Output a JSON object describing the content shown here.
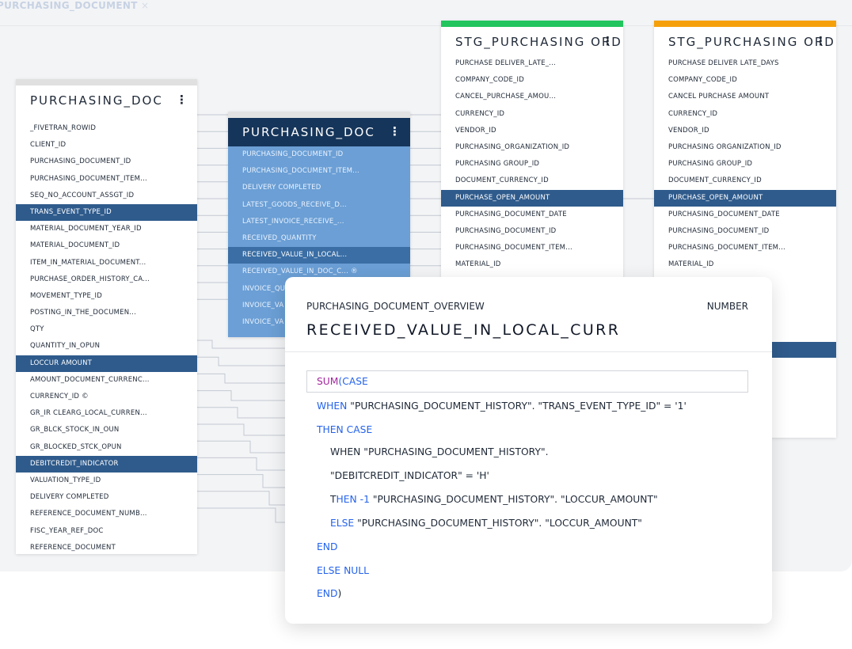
{
  "tab": {
    "title": "PURCHASING_DOCUMENT",
    "close_icon": "close-icon"
  },
  "colors": {
    "selected_row": "#2f5b8c",
    "blue_card": "#6b9fd5",
    "blue_card_header": "#16355a",
    "stg1_accent": "#22c55e",
    "stg2_accent": "#f5a00b",
    "keyword": "#2563eb",
    "function": "#a3279e"
  },
  "card_left": {
    "title": "PURCHASING_DOC",
    "menu_icon": "kebab-menu-icon",
    "rows": [
      {
        "label": "_FIVETRAN_ROWID",
        "selected": false
      },
      {
        "label": "CLIENT_ID",
        "selected": false
      },
      {
        "label": "PURCHASING_DOCUMENT_ID",
        "selected": false
      },
      {
        "label": "PURCHASING_DOCUMENT_ITEM...",
        "selected": false
      },
      {
        "label": "SEQ_NO_ACCOUNT_ASSGT_ID",
        "selected": false
      },
      {
        "label": "TRANS_EVENT_TYPE_ID",
        "selected": true
      },
      {
        "label": "MATERIAL_DOCUMENT_YEAR_ID",
        "selected": false
      },
      {
        "label": "MATERIAL_DOCUMENT_ID",
        "selected": false
      },
      {
        "label": "ITEM_IN_MATERIAL_DOCUMENT...",
        "selected": false
      },
      {
        "label": "PURCHASE_ORDER_HISTORY_CA...",
        "selected": false
      },
      {
        "label": "MOVEMENT_TYPE_ID",
        "selected": false
      },
      {
        "label": "POSTING_IN_THE_DOCUMEN...",
        "selected": false
      },
      {
        "label": "QTY",
        "selected": false
      },
      {
        "label": "QUANTITY_IN_OPUN",
        "selected": false
      },
      {
        "label": "LOCCUR AMOUNT",
        "selected": true
      },
      {
        "label": "AMOUNT_DOCUMENT_CURRENC...",
        "selected": false
      },
      {
        "label": "CURRENCY_ID ©",
        "selected": false
      },
      {
        "label": "GR_IR CLEARG_LOCAL_CURREN...",
        "selected": false
      },
      {
        "label": "GR_BLCK_STOCK_IN_OUN",
        "selected": false
      },
      {
        "label": "GR_BLOCKED_STCK_OPUN",
        "selected": false
      },
      {
        "label": "DEBITCREDIT_INDICATOR",
        "selected": true
      },
      {
        "label": "VALUATION_TYPE_ID",
        "selected": false
      },
      {
        "label": "DELIVERY COMPLETED",
        "selected": false
      },
      {
        "label": "REFERENCE_DOCUMENT_NUMB...",
        "selected": false
      },
      {
        "label": "FISC_YEAR_REF_DOC",
        "selected": false
      },
      {
        "label": "REFERENCE_DOCUMENT",
        "selected": false
      }
    ]
  },
  "card_blue": {
    "title": "PURCHASING_DOC",
    "menu_icon": "kebab-menu-icon",
    "rows": [
      {
        "label": "PURCHASING_DOCUMENT_ID",
        "selected": false
      },
      {
        "label": "PURCHASING_DOCUMENT_ITEM...",
        "selected": false
      },
      {
        "label": "DELIVERY COMPLETED",
        "selected": false
      },
      {
        "label": "LATEST_GOODS_RECEIVE_D...",
        "selected": false
      },
      {
        "label": "LATEST_INVOICE_RECEIVE_...",
        "selected": false
      },
      {
        "label": "RECEIVED_QUANTITY",
        "selected": false
      },
      {
        "label": "RECEIVED_VALUE_IN_LOCAL...",
        "selected": true
      },
      {
        "label": "RECEIVED_VALUE_IN_DOC_C... ®",
        "selected": false
      },
      {
        "label": "INVOICE_QU",
        "selected": false
      },
      {
        "label": "INVOICE_VA",
        "selected": false
      },
      {
        "label": "INVOICE_VA",
        "selected": false
      }
    ]
  },
  "card_stg_1": {
    "title": "STG_PURCHASING ORD",
    "menu_icon": "kebab-menu-icon",
    "rows": [
      {
        "label": "PURCHASE DELIVER_LATE_...",
        "selected": false
      },
      {
        "label": "COMPANY_CODE_ID",
        "selected": false
      },
      {
        "label": "CANCEL_PURCHASE_AMOU...",
        "selected": false
      },
      {
        "label": "CURRENCY_ID",
        "selected": false
      },
      {
        "label": "VENDOR_ID",
        "selected": false
      },
      {
        "label": "PURCHASING_ORGANIZATION_ID",
        "selected": false
      },
      {
        "label": "PURCHASING GROUP_ID",
        "selected": false
      },
      {
        "label": "DOCUMENT_CURRENCY_ID",
        "selected": false
      },
      {
        "label": "PURCHASE_OPEN_AMOUNT",
        "selected": true
      },
      {
        "label": "PURCHASING_DOCUMENT_DATE",
        "selected": false
      },
      {
        "label": "PURCHASING_DOCUMENT_ID",
        "selected": false
      },
      {
        "label": "PURCHASING_DOCUMENT_ITEM...",
        "selected": false
      },
      {
        "label": "MATERIAL_ID",
        "selected": false
      }
    ]
  },
  "card_stg_2": {
    "title": "STG_PURCHASING ORD",
    "menu_icon": "kebab-menu-icon",
    "rows": [
      {
        "label": "PURCHASE DELIVER LATE_DAYS",
        "selected": false
      },
      {
        "label": "COMPANY_CODE_ID",
        "selected": false
      },
      {
        "label": "CANCEL PURCHASE AMOUNT",
        "selected": false
      },
      {
        "label": "CURRENCY_ID",
        "selected": false
      },
      {
        "label": "VENDOR_ID",
        "selected": false
      },
      {
        "label": "PURCHASING ORGANIZATION_ID",
        "selected": false
      },
      {
        "label": "PURCHASING GROUP_ID",
        "selected": false
      },
      {
        "label": "DOCUMENT_CURRENCY_ID",
        "selected": false
      },
      {
        "label": "PURCHASE_OPEN_AMOUNT",
        "selected": true
      },
      {
        "label": "PURCHASING_DOCUMENT_DATE",
        "selected": false
      },
      {
        "label": "PURCHASING_DOCUMENT_ID",
        "selected": false
      },
      {
        "label": "PURCHASING_DOCUMENT_ITEM...",
        "selected": false
      },
      {
        "label": "MATERIAL_ID",
        "selected": false
      }
    ]
  },
  "detail": {
    "source": "PURCHASING_DOCUMENT_OVERVIEW",
    "data_type": "NUMBER",
    "field_name": "RECEIVED_VALUE_IN_LOCAL_CURR",
    "code": {
      "sum_fn": "SUM",
      "paren_open": "(",
      "case_kw": "CASE",
      "when_kw": "WHEN",
      "when_cond": " \"PURCHASING_DOCUMENT_HISTORY\". \"TRANS_EVENT_TYPE_ID\" = '1'",
      "then_case": "THEN CASE",
      "inner_when": "WHEN \"PURCHASING_DOCUMENT_HISTORY\".",
      "inner_cond": "\"DEBITCREDIT_INDICATOR\" = 'H'",
      "inner_then_t": "T",
      "inner_then_rest": "HEN -1",
      "inner_then_expr": " \"PURCHASING_DOCUMENT_HISTORY\". \"LOCCUR_AMOUNT\"",
      "inner_else_kw": "ELSE",
      "inner_else_expr": " \"PURCHASING_DOCUMENT_HISTORY\". \"LOCCUR_AMOUNT\"",
      "end1": "END",
      "else_null": "ELSE NULL",
      "end2": "END",
      "paren_close": ")"
    }
  }
}
